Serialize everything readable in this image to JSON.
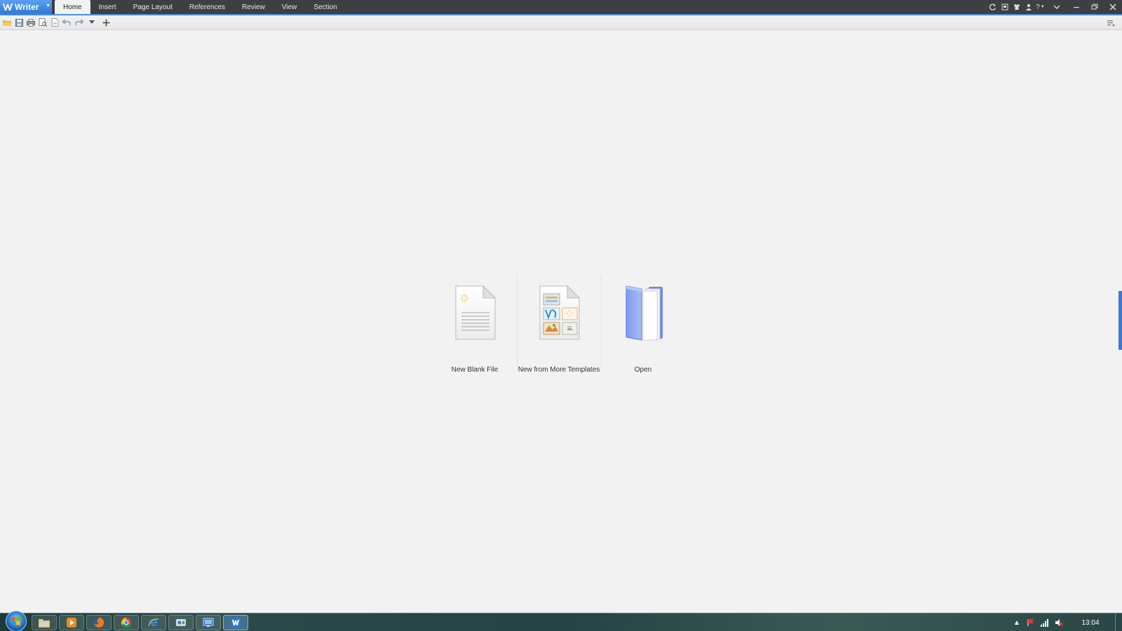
{
  "app": {
    "name": "Writer",
    "brand_color": "#3b82e0"
  },
  "menu": {
    "tabs": [
      {
        "label": "Home",
        "active": true
      },
      {
        "label": "Insert"
      },
      {
        "label": "Page Layout"
      },
      {
        "label": "References"
      },
      {
        "label": "Review"
      },
      {
        "label": "View"
      },
      {
        "label": "Section"
      }
    ],
    "right_icons": [
      "refresh-icon",
      "bookmark-icon",
      "shirt-icon",
      "user-icon",
      "help-icon",
      "ribbon-collapse-icon"
    ],
    "help_glyph": "?",
    "window_controls": [
      "minimize-icon",
      "restore-icon",
      "close-icon"
    ]
  },
  "quick_access": {
    "icons": [
      "open-folder-icon",
      "save-icon",
      "print-icon",
      "print-preview-icon",
      "export-pdf-icon",
      "undo-icon",
      "redo-icon",
      "customize-dropdown-icon",
      "new-tab-plus-icon"
    ]
  },
  "start": {
    "items": [
      {
        "label": "New Blank File",
        "icon": "blank-document-icon"
      },
      {
        "label": "New from More Templates",
        "icon": "templates-document-icon"
      },
      {
        "label": "Open",
        "icon": "open-folder-icon"
      }
    ]
  },
  "taskbar": {
    "apps": [
      "file-explorer-icon",
      "media-player-icon",
      "firefox-icon",
      "chrome-icon",
      "internet-explorer-icon",
      "control-panel-icon",
      "remote-desktop-icon",
      "wps-writer-icon"
    ],
    "tray_icons": [
      "show-hidden-icons-icon",
      "action-center-icon",
      "network-icon",
      "volume-icon"
    ],
    "clock": "13:04"
  }
}
